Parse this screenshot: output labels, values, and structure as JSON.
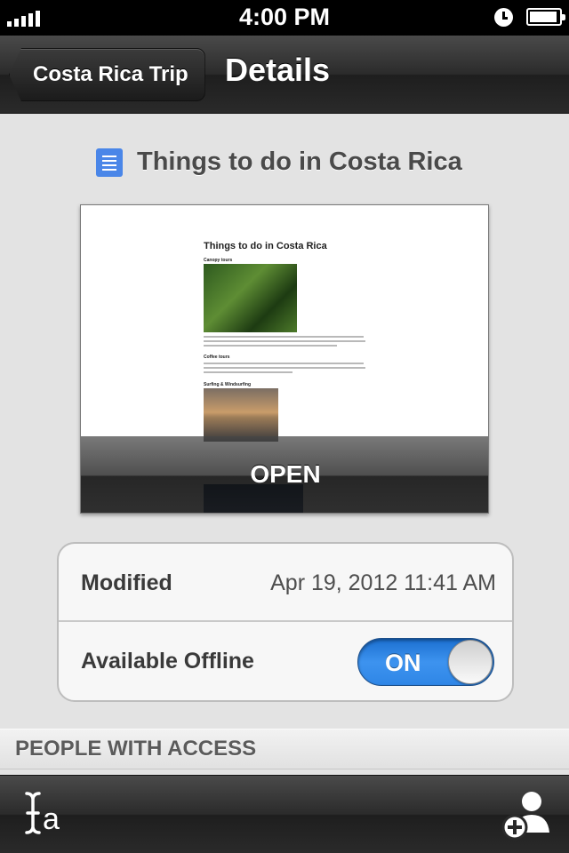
{
  "status_bar": {
    "time": "4:00 PM"
  },
  "nav": {
    "back_label": "Costa Rica Trip",
    "title": "Details"
  },
  "document": {
    "title": "Things to do in Costa Rica",
    "icon": "google-doc-icon",
    "preview": {
      "heading": "Things to do in Costa Rica",
      "sections": [
        "Canopy tours",
        "Coffee tours",
        "Surfing & Windsurfing"
      ]
    },
    "open_label": "OPEN"
  },
  "info": {
    "modified_label": "Modified",
    "modified_value": "Apr 19, 2012 11:41 AM",
    "offline_label": "Available Offline",
    "offline_state": "ON"
  },
  "sections": {
    "people_header": "PEOPLE WITH ACCESS"
  },
  "toolbar": {
    "left_icon": "text-format-icon",
    "right_icon": "add-person-icon"
  },
  "colors": {
    "accent": "#3d93ef",
    "doc_icon": "#4a86e8",
    "bar": "#2b2b2b"
  }
}
